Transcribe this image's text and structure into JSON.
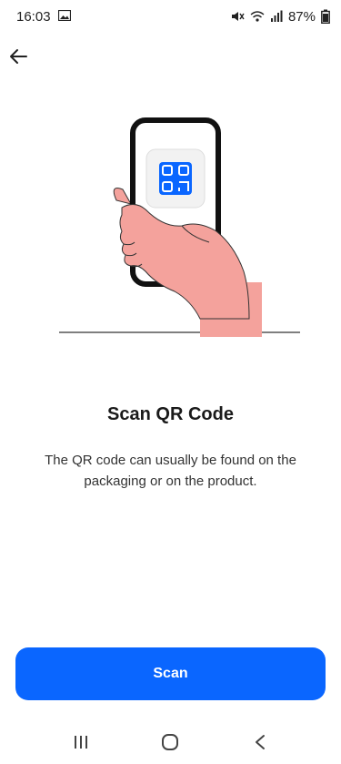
{
  "status_bar": {
    "time": "16:03",
    "battery": "87%",
    "icons": [
      "gallery-icon",
      "mute-icon",
      "wifi-icon",
      "signal-icon",
      "battery-icon"
    ]
  },
  "header": {
    "back_icon": "back-arrow-icon"
  },
  "illustration": {
    "icon": "qr-code-icon",
    "description_icon": "hand-holding-phone-illustration"
  },
  "content": {
    "title": "Scan QR Code",
    "description": "The QR code can usually be found on the packaging or on the product."
  },
  "actions": {
    "scan_label": "Scan"
  },
  "nav_bar": {
    "items": [
      "recent-apps-icon",
      "home-icon",
      "back-icon"
    ]
  },
  "colors": {
    "accent": "#0a66ff",
    "skin": "#f4a29c",
    "phone_frame": "#111111"
  }
}
